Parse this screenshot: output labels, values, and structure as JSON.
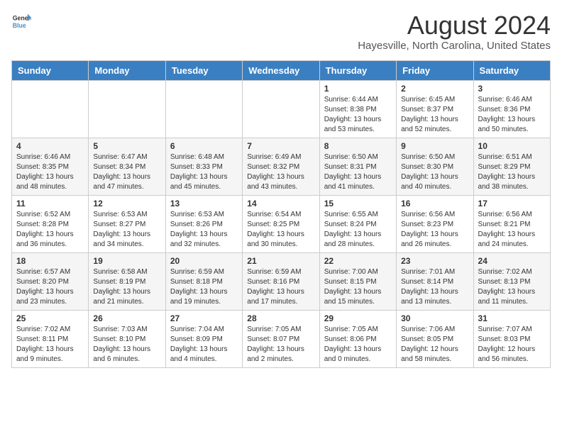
{
  "logo": {
    "general": "General",
    "blue": "Blue"
  },
  "header": {
    "title": "August 2024",
    "subtitle": "Hayesville, North Carolina, United States"
  },
  "weekdays": [
    "Sunday",
    "Monday",
    "Tuesday",
    "Wednesday",
    "Thursday",
    "Friday",
    "Saturday"
  ],
  "weeks": [
    [
      {
        "day": "",
        "info": ""
      },
      {
        "day": "",
        "info": ""
      },
      {
        "day": "",
        "info": ""
      },
      {
        "day": "",
        "info": ""
      },
      {
        "day": "1",
        "info": "Sunrise: 6:44 AM\nSunset: 8:38 PM\nDaylight: 13 hours and 53 minutes."
      },
      {
        "day": "2",
        "info": "Sunrise: 6:45 AM\nSunset: 8:37 PM\nDaylight: 13 hours and 52 minutes."
      },
      {
        "day": "3",
        "info": "Sunrise: 6:46 AM\nSunset: 8:36 PM\nDaylight: 13 hours and 50 minutes."
      }
    ],
    [
      {
        "day": "4",
        "info": "Sunrise: 6:46 AM\nSunset: 8:35 PM\nDaylight: 13 hours and 48 minutes."
      },
      {
        "day": "5",
        "info": "Sunrise: 6:47 AM\nSunset: 8:34 PM\nDaylight: 13 hours and 47 minutes."
      },
      {
        "day": "6",
        "info": "Sunrise: 6:48 AM\nSunset: 8:33 PM\nDaylight: 13 hours and 45 minutes."
      },
      {
        "day": "7",
        "info": "Sunrise: 6:49 AM\nSunset: 8:32 PM\nDaylight: 13 hours and 43 minutes."
      },
      {
        "day": "8",
        "info": "Sunrise: 6:50 AM\nSunset: 8:31 PM\nDaylight: 13 hours and 41 minutes."
      },
      {
        "day": "9",
        "info": "Sunrise: 6:50 AM\nSunset: 8:30 PM\nDaylight: 13 hours and 40 minutes."
      },
      {
        "day": "10",
        "info": "Sunrise: 6:51 AM\nSunset: 8:29 PM\nDaylight: 13 hours and 38 minutes."
      }
    ],
    [
      {
        "day": "11",
        "info": "Sunrise: 6:52 AM\nSunset: 8:28 PM\nDaylight: 13 hours and 36 minutes."
      },
      {
        "day": "12",
        "info": "Sunrise: 6:53 AM\nSunset: 8:27 PM\nDaylight: 13 hours and 34 minutes."
      },
      {
        "day": "13",
        "info": "Sunrise: 6:53 AM\nSunset: 8:26 PM\nDaylight: 13 hours and 32 minutes."
      },
      {
        "day": "14",
        "info": "Sunrise: 6:54 AM\nSunset: 8:25 PM\nDaylight: 13 hours and 30 minutes."
      },
      {
        "day": "15",
        "info": "Sunrise: 6:55 AM\nSunset: 8:24 PM\nDaylight: 13 hours and 28 minutes."
      },
      {
        "day": "16",
        "info": "Sunrise: 6:56 AM\nSunset: 8:23 PM\nDaylight: 13 hours and 26 minutes."
      },
      {
        "day": "17",
        "info": "Sunrise: 6:56 AM\nSunset: 8:21 PM\nDaylight: 13 hours and 24 minutes."
      }
    ],
    [
      {
        "day": "18",
        "info": "Sunrise: 6:57 AM\nSunset: 8:20 PM\nDaylight: 13 hours and 23 minutes."
      },
      {
        "day": "19",
        "info": "Sunrise: 6:58 AM\nSunset: 8:19 PM\nDaylight: 13 hours and 21 minutes."
      },
      {
        "day": "20",
        "info": "Sunrise: 6:59 AM\nSunset: 8:18 PM\nDaylight: 13 hours and 19 minutes."
      },
      {
        "day": "21",
        "info": "Sunrise: 6:59 AM\nSunset: 8:16 PM\nDaylight: 13 hours and 17 minutes."
      },
      {
        "day": "22",
        "info": "Sunrise: 7:00 AM\nSunset: 8:15 PM\nDaylight: 13 hours and 15 minutes."
      },
      {
        "day": "23",
        "info": "Sunrise: 7:01 AM\nSunset: 8:14 PM\nDaylight: 13 hours and 13 minutes."
      },
      {
        "day": "24",
        "info": "Sunrise: 7:02 AM\nSunset: 8:13 PM\nDaylight: 13 hours and 11 minutes."
      }
    ],
    [
      {
        "day": "25",
        "info": "Sunrise: 7:02 AM\nSunset: 8:11 PM\nDaylight: 13 hours and 9 minutes."
      },
      {
        "day": "26",
        "info": "Sunrise: 7:03 AM\nSunset: 8:10 PM\nDaylight: 13 hours and 6 minutes."
      },
      {
        "day": "27",
        "info": "Sunrise: 7:04 AM\nSunset: 8:09 PM\nDaylight: 13 hours and 4 minutes."
      },
      {
        "day": "28",
        "info": "Sunrise: 7:05 AM\nSunset: 8:07 PM\nDaylight: 13 hours and 2 minutes."
      },
      {
        "day": "29",
        "info": "Sunrise: 7:05 AM\nSunset: 8:06 PM\nDaylight: 13 hours and 0 minutes."
      },
      {
        "day": "30",
        "info": "Sunrise: 7:06 AM\nSunset: 8:05 PM\nDaylight: 12 hours and 58 minutes."
      },
      {
        "day": "31",
        "info": "Sunrise: 7:07 AM\nSunset: 8:03 PM\nDaylight: 12 hours and 56 minutes."
      }
    ]
  ]
}
